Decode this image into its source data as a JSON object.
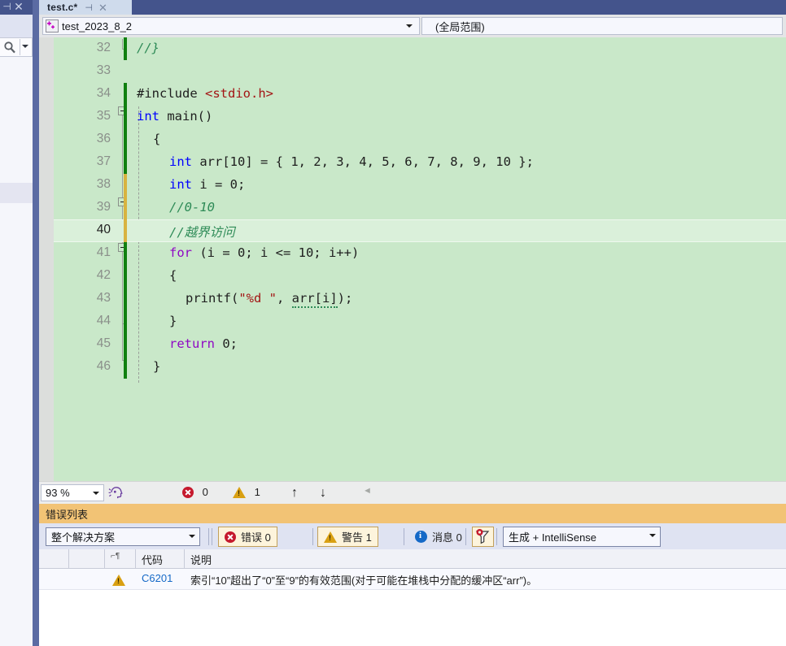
{
  "tool_window": {
    "pin_icon": "pin-icon",
    "close_icon": "close-icon",
    "search_icon": "search-icon"
  },
  "tab": {
    "label": "test.c*",
    "pin_icon": "pin-icon",
    "close_icon": "close-icon"
  },
  "navbar": {
    "project_icon": "cpp-project-icon",
    "project": "test_2023_8_2",
    "scope": "(全局范围)"
  },
  "editor": {
    "zoom": "93 %",
    "errors_label": "0",
    "warnings_label": "1",
    "up_arrow": "↑",
    "down_arrow": "↓",
    "left_arrow": "◄",
    "lines": [
      {
        "no": "32",
        "current": false,
        "change": "saved",
        "tokens": [
          {
            "t": "//}",
            "c": "tok-cmt"
          }
        ],
        "indent": 0
      },
      {
        "no": "33",
        "current": false,
        "change": "none",
        "tokens": [],
        "indent": 0
      },
      {
        "no": "34",
        "current": false,
        "change": "saved",
        "tokens": [
          {
            "t": "#include ",
            "c": "tok-pre"
          },
          {
            "t": "<stdio.h>",
            "c": "tok-inc"
          }
        ],
        "indent": 0
      },
      {
        "no": "35",
        "current": false,
        "change": "saved",
        "tokens": [
          {
            "t": "int",
            "c": "tok-key"
          },
          {
            "t": " main()",
            "c": "tok-pln"
          }
        ],
        "indent": 0
      },
      {
        "no": "36",
        "current": false,
        "change": "saved",
        "tokens": [
          {
            "t": "{",
            "c": "tok-pln"
          }
        ],
        "indent": 1
      },
      {
        "no": "37",
        "current": false,
        "change": "saved",
        "tokens": [
          {
            "t": "int",
            "c": "tok-key"
          },
          {
            "t": " arr[10] = { 1, 2, 3, 4, 5, 6, 7, 8, 9, 10 };",
            "c": "tok-pln"
          }
        ],
        "indent": 2
      },
      {
        "no": "38",
        "current": false,
        "change": "unsaved",
        "tokens": [
          {
            "t": "int",
            "c": "tok-key"
          },
          {
            "t": " i = 0;",
            "c": "tok-pln"
          }
        ],
        "indent": 2
      },
      {
        "no": "39",
        "current": false,
        "change": "unsaved",
        "tokens": [
          {
            "t": "//0-10",
            "c": "tok-cmt"
          }
        ],
        "indent": 2
      },
      {
        "no": "40",
        "current": true,
        "change": "unsaved",
        "tokens": [
          {
            "t": "//越界访问",
            "c": "tok-cmt"
          }
        ],
        "indent": 2
      },
      {
        "no": "41",
        "current": false,
        "change": "saved",
        "tokens": [
          {
            "t": "for",
            "c": "tok-kw2"
          },
          {
            "t": " (i = 0; i <= 10; i++)",
            "c": "tok-pln"
          }
        ],
        "indent": 2
      },
      {
        "no": "42",
        "current": false,
        "change": "saved",
        "tokens": [
          {
            "t": "{",
            "c": "tok-pln"
          }
        ],
        "indent": 2
      },
      {
        "no": "43",
        "current": false,
        "change": "saved",
        "tokens": [
          {
            "t": "printf(",
            "c": "tok-pln"
          },
          {
            "t": "\"%d \"",
            "c": "tok-str"
          },
          {
            "t": ", ",
            "c": "tok-pln"
          },
          {
            "t": "arr[i]",
            "c": "squig"
          },
          {
            "t": ");",
            "c": "tok-pln"
          }
        ],
        "indent": 3
      },
      {
        "no": "44",
        "current": false,
        "change": "saved",
        "tokens": [
          {
            "t": "}",
            "c": "tok-pln"
          }
        ],
        "indent": 2
      },
      {
        "no": "45",
        "current": false,
        "change": "saved",
        "tokens": [
          {
            "t": "return",
            "c": "tok-kw2"
          },
          {
            "t": " 0;",
            "c": "tok-pln"
          }
        ],
        "indent": 2
      },
      {
        "no": "46",
        "current": false,
        "change": "saved",
        "tokens": [
          {
            "t": "}",
            "c": "tok-pln"
          }
        ],
        "indent": 1
      }
    ]
  },
  "error_list": {
    "title": "错误列表",
    "scope_filter": "整个解决方案",
    "errors_button": "错误 0",
    "warnings_button": "警告 1",
    "messages_button": "消息 0",
    "filter_icon": "filter-funnel-icon",
    "build_filter": "生成 + IntelliSense",
    "columns": [
      "",
      "",
      "代码",
      "说明"
    ],
    "rows": [
      {
        "severity": "warning",
        "code": "C6201",
        "description": "索引“10”超出了“0”至“9”的有效范围(对于可能在堆栈中分配的缓冲区“arr”)。"
      }
    ]
  },
  "colors": {
    "editor_bg": "#c9e8c9",
    "title_blue": "#44548c",
    "saved_change": "#108010",
    "unsaved_change": "#d8b340",
    "error_red": "#c5192d",
    "warning_amber": "#d9a012",
    "info_blue": "#1569c7",
    "errorlist_caption": "#f2c375"
  }
}
